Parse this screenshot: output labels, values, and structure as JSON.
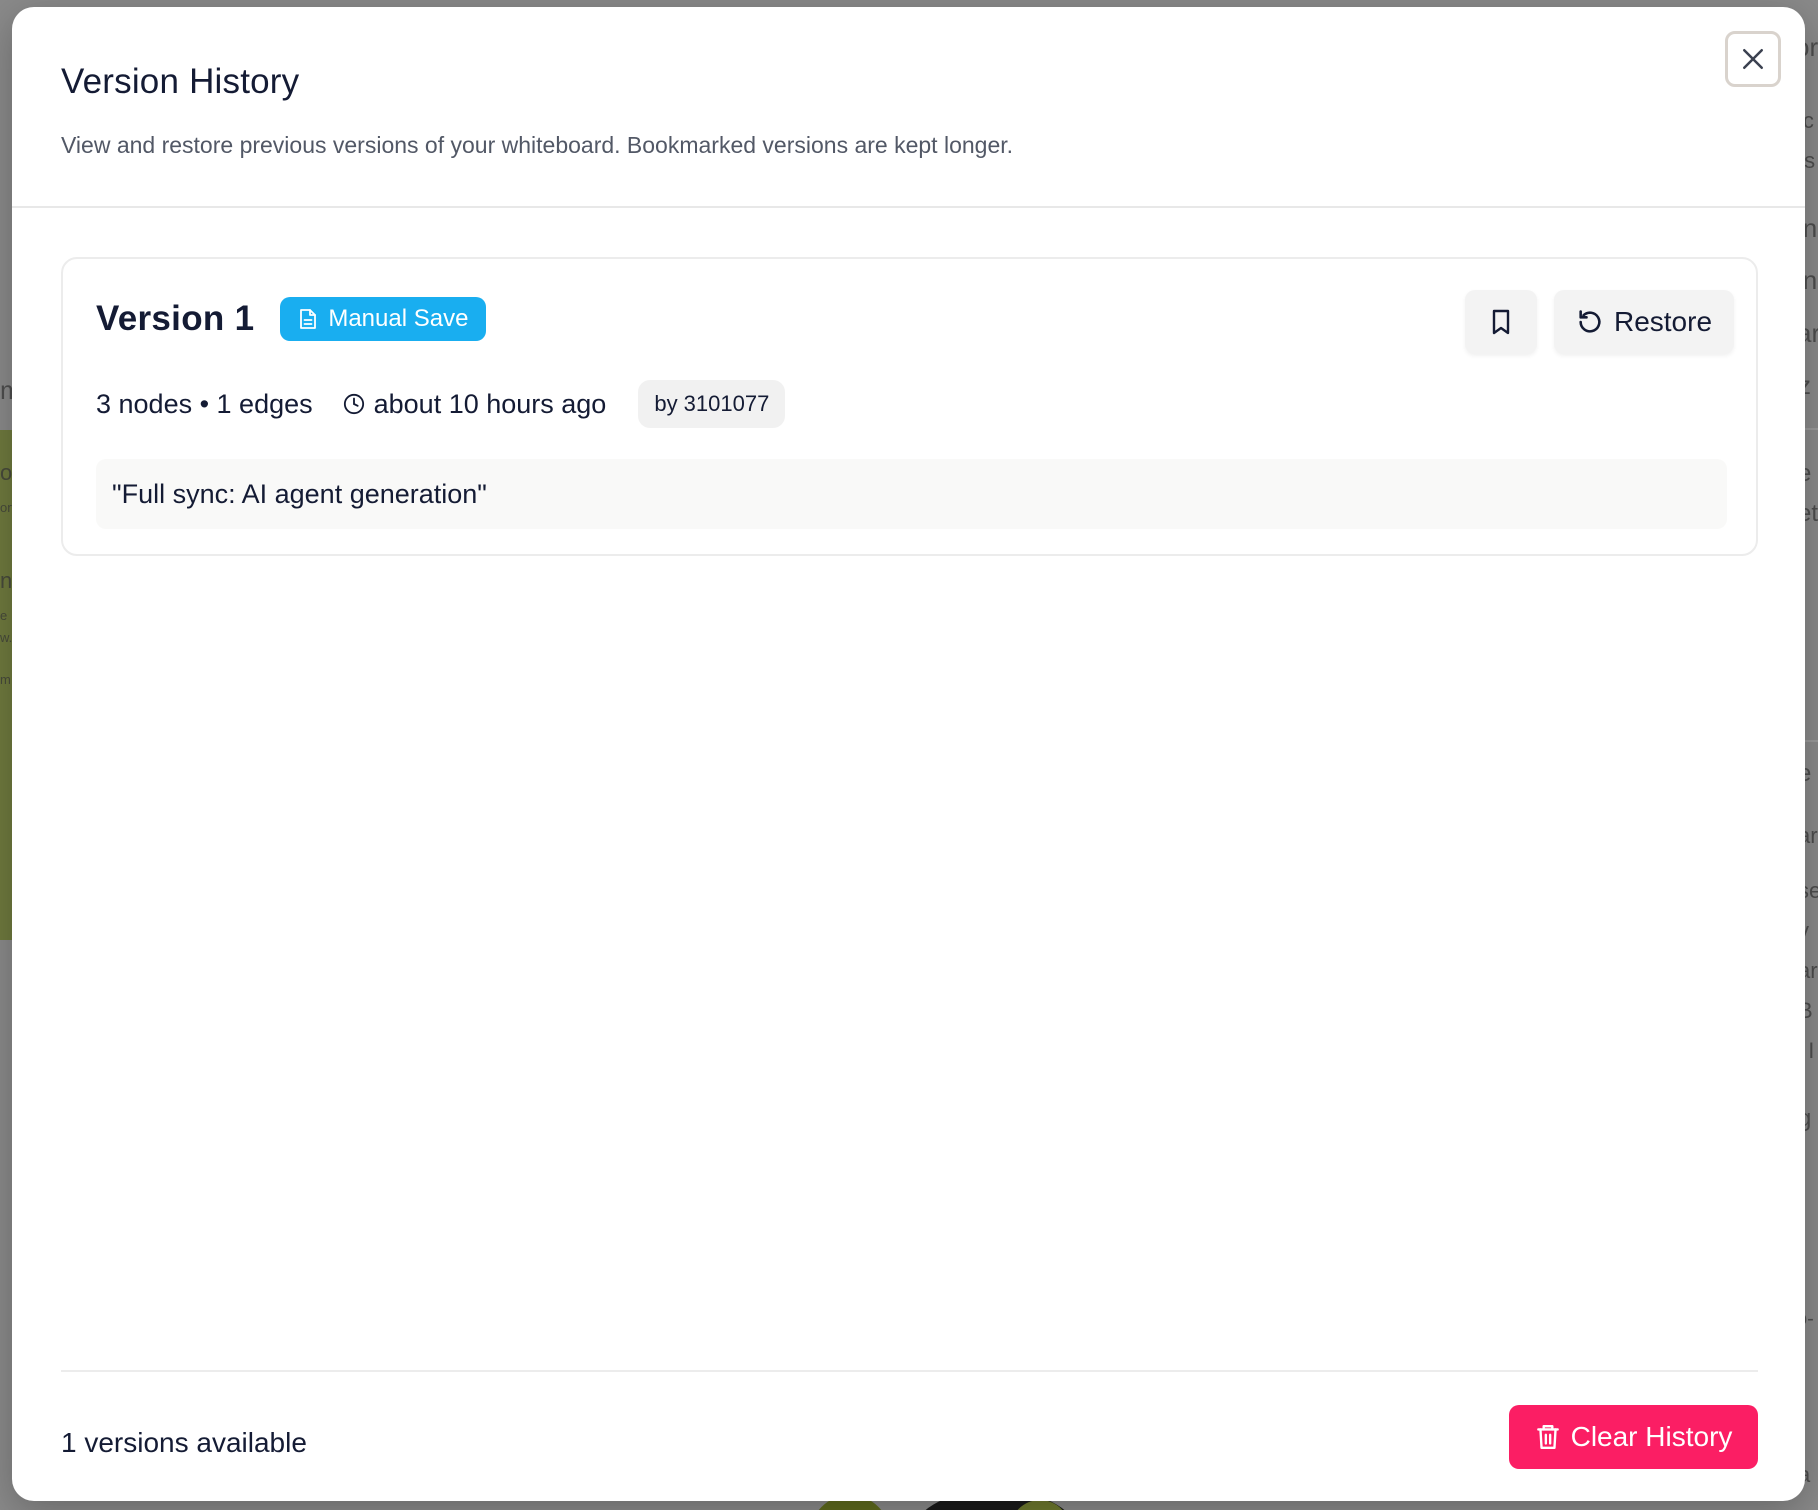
{
  "background": {
    "fragments": [
      "or",
      "ic",
      "ts",
      "in",
      "in",
      "ar",
      "z",
      "m",
      "ot",
      "ort",
      "e",
      "et",
      "n",
      "e",
      "w.",
      "m",
      "e",
      "ar",
      "se",
      "y",
      "ar",
      "B",
      ", I",
      "g",
      "o-",
      "a"
    ]
  },
  "modal": {
    "title": "Version History",
    "subtitle": "View and restore previous versions of your whiteboard. Bookmarked versions are kept longer.",
    "close_icon": "close-icon"
  },
  "versions": [
    {
      "title": "Version 1",
      "badge": "Manual Save",
      "badge_icon": "document-icon",
      "counts": "3 nodes • 1 edges",
      "time": "about 10 hours ago",
      "author": "by 3101077",
      "message": "\"Full sync: AI agent generation\"",
      "restore_label": "Restore"
    }
  ],
  "footer": {
    "count_text": "1 versions available",
    "clear_label": "Clear History"
  },
  "colors": {
    "badge": "#19aef0",
    "danger": "#fb1e64",
    "text": "#141b34"
  }
}
